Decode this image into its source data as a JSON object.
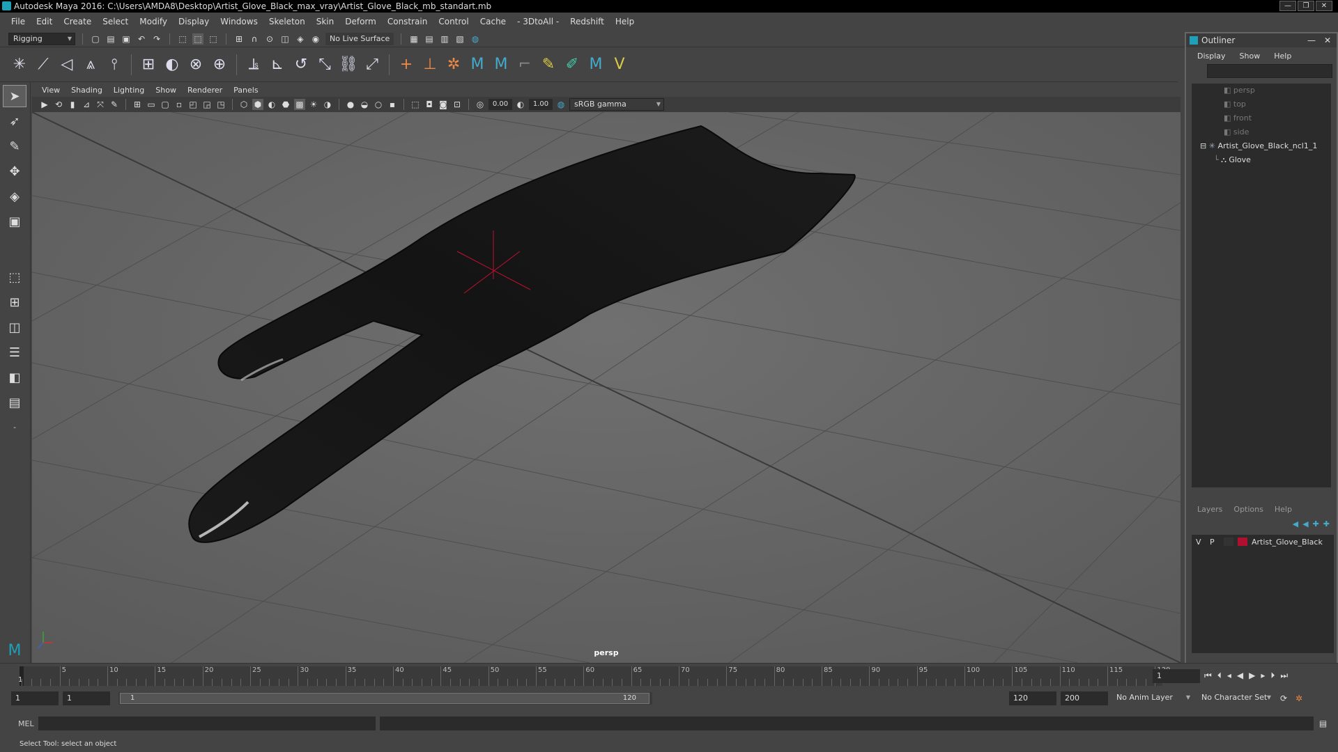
{
  "window": {
    "title": "Autodesk Maya 2016: C:\\Users\\AMDA8\\Desktop\\Artist_Glove_Black_max_vray\\Artist_Glove_Black_mb_standart.mb"
  },
  "menubar": [
    "File",
    "Edit",
    "Create",
    "Select",
    "Modify",
    "Display",
    "Windows",
    "Skeleton",
    "Skin",
    "Deform",
    "Constrain",
    "Control",
    "Cache",
    "- 3DtoAll -",
    "Redshift",
    "Help"
  ],
  "statusline": {
    "mode": "Rigging",
    "live_surface": "No Live Surface"
  },
  "viewport": {
    "menu": [
      "View",
      "Shading",
      "Lighting",
      "Show",
      "Renderer",
      "Panels"
    ],
    "exposure": "0.00",
    "gamma": "1.00",
    "color_space": "sRGB gamma",
    "camera_label": "persp"
  },
  "outliner": {
    "title": "Outliner",
    "menu": [
      "Display",
      "Show",
      "Help"
    ],
    "items": [
      {
        "label": "persp",
        "dim": true
      },
      {
        "label": "top",
        "dim": true
      },
      {
        "label": "front",
        "dim": true
      },
      {
        "label": "side",
        "dim": true
      },
      {
        "label": "Artist_Glove_Black_ncl1_1",
        "dim": false
      },
      {
        "label": "Glove",
        "dim": false
      }
    ]
  },
  "layers": {
    "menu": [
      "Layers",
      "Options",
      "Help"
    ],
    "row": {
      "v": "V",
      "p": "P",
      "name": "Artist_Glove_Black",
      "color": "#b01030"
    }
  },
  "timeline": {
    "ticks": [
      "5",
      "10",
      "15",
      "20",
      "25",
      "30",
      "35",
      "40",
      "45",
      "50",
      "55",
      "60",
      "65",
      "70",
      "75",
      "80",
      "85",
      "90",
      "95",
      "100",
      "105",
      "110",
      "115",
      "120"
    ],
    "start_label": "1",
    "current_frame": "1"
  },
  "range": {
    "start": "1",
    "playback_start": "1",
    "slider_start": "1",
    "slider_end": "120",
    "playback_end": "120",
    "end": "200",
    "anim_layer": "No Anim Layer",
    "character_set": "No Character Set"
  },
  "cmdline": {
    "label": "MEL"
  },
  "helpline": {
    "text": "Select Tool: select an object"
  }
}
